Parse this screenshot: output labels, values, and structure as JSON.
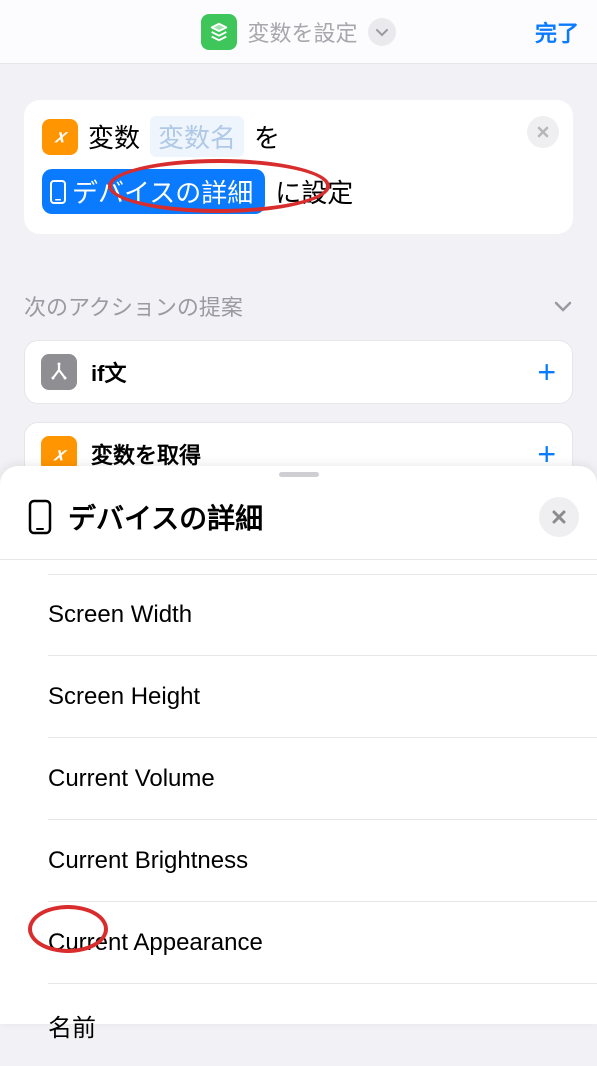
{
  "header": {
    "title": "変数を設定",
    "done_label": "完了"
  },
  "action_card": {
    "prefix": "変数",
    "placeholder": "変数名",
    "middle": "を",
    "token_label": "デバイスの詳細",
    "suffix": "に設定",
    "icon_glyph": "𝑥"
  },
  "suggestions": {
    "header_label": "次のアクションの提案",
    "items": [
      {
        "label": "if文",
        "icon": "branch",
        "icon_bg": "gray"
      },
      {
        "label": "変数を取得",
        "icon": "x",
        "icon_bg": "orange"
      }
    ]
  },
  "sheet": {
    "title": "デバイスの詳細",
    "items": [
      "Screen Width",
      "Screen Height",
      "Current Volume",
      "Current Brightness",
      "Current Appearance",
      "名前"
    ]
  }
}
